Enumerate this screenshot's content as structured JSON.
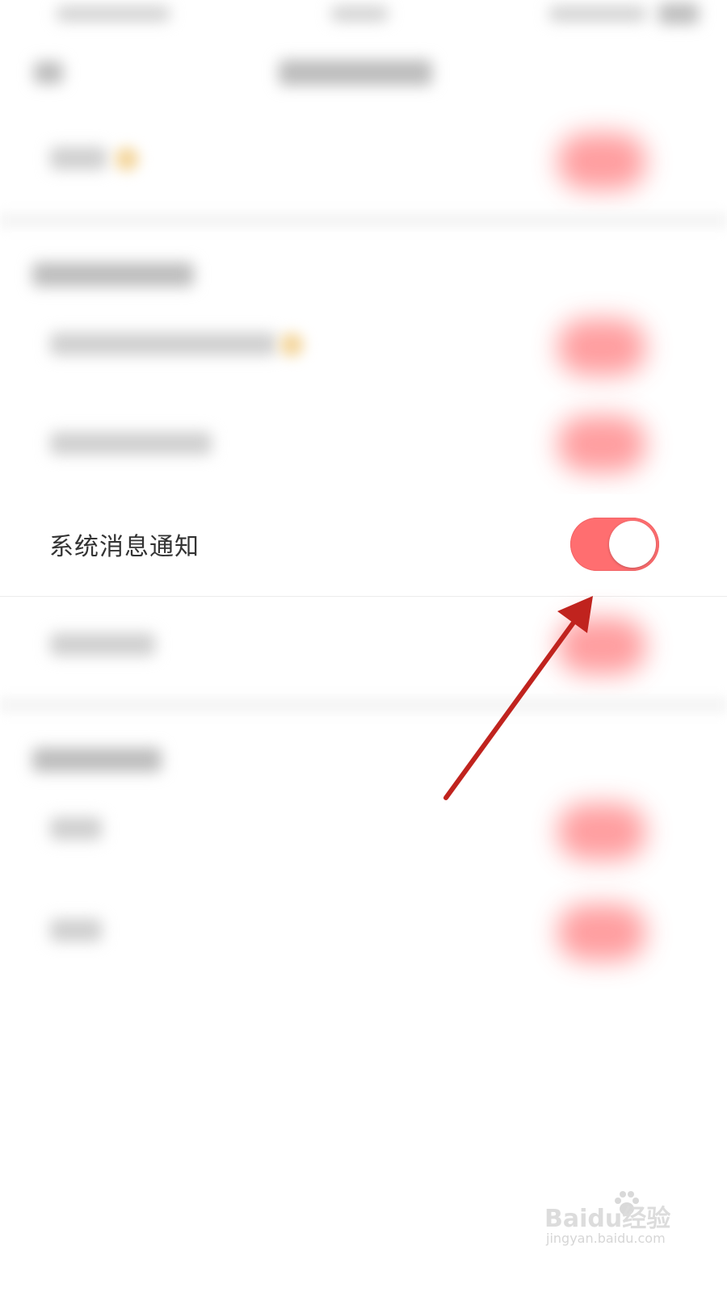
{
  "settings": {
    "focused_row": {
      "label": "系统消息通知",
      "toggle_on": true
    }
  },
  "colors": {
    "toggle_on": "#ff6e70",
    "arrow": "#c0231e",
    "blurred_toggle": "#ff8d8f"
  },
  "watermark": {
    "brand": "Baidu经验",
    "url": "jingyan.baidu.com"
  }
}
